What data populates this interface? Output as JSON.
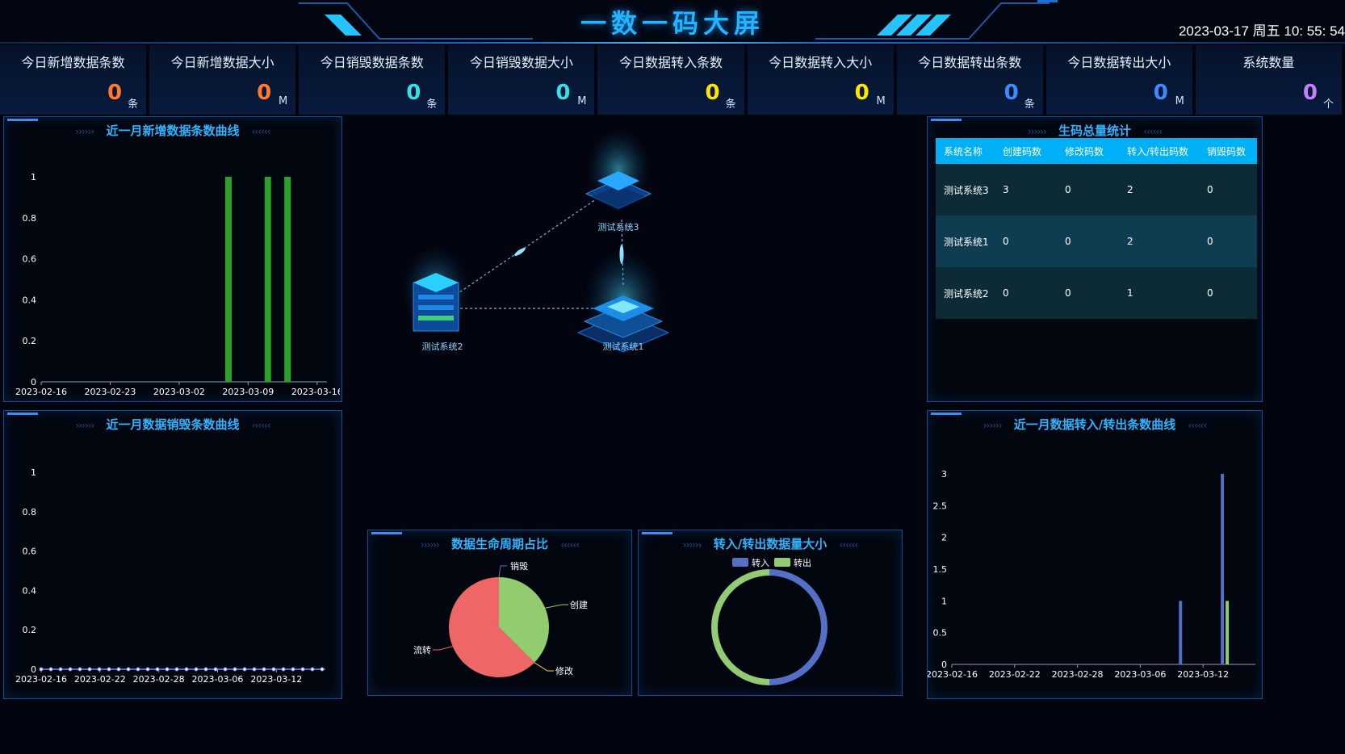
{
  "header": {
    "title": "一数一码大屏",
    "datetime": "2023-03-17 周五 10: 55: 54"
  },
  "stats": [
    {
      "label": "今日新增数据条数",
      "value": "0",
      "unit": "条",
      "color": "#ff7a2e"
    },
    {
      "label": "今日新增数据大小",
      "value": "0",
      "unit": "M",
      "color": "#ff7a2e"
    },
    {
      "label": "今日销毁数据条数",
      "value": "0",
      "unit": "条",
      "color": "#36e0e8"
    },
    {
      "label": "今日销毁数据大小",
      "value": "0",
      "unit": "M",
      "color": "#36e0e8"
    },
    {
      "label": "今日数据转入条数",
      "value": "0",
      "unit": "条",
      "color": "#ffe600"
    },
    {
      "label": "今日数据转入大小",
      "value": "0",
      "unit": "M",
      "color": "#ffe600"
    },
    {
      "label": "今日数据转出条数",
      "value": "0",
      "unit": "条",
      "color": "#3d8bff"
    },
    {
      "label": "今日数据转出大小",
      "value": "0",
      "unit": "M",
      "color": "#3d8bff"
    },
    {
      "label": "系统数量",
      "value": "0",
      "unit": "个",
      "color": "#c77dff"
    }
  ],
  "panels": {
    "new_curve": {
      "title": "近一月新增数据条数曲线",
      "arrows_left": "››››››",
      "arrows_right": "‹‹‹‹‹‹"
    },
    "destroy_curve": {
      "title": "近一月数据销毁条数曲线",
      "arrows_left": "››››››",
      "arrows_right": "‹‹‹‹‹‹"
    },
    "code_stats": {
      "title": "生码总量统计",
      "arrows_left": "››››››",
      "arrows_right": "‹‹‹‹‹‹"
    },
    "transfer_curve": {
      "title": "近一月数据转入/转出条数曲线",
      "arrows_left": "››››››",
      "arrows_right": "‹‹‹‹‹‹"
    },
    "lifecycle": {
      "title": "数据生命周期占比",
      "arrows_left": "››››››",
      "arrows_right": "‹‹‹‹‹‹"
    },
    "transfer_size": {
      "title": "转入/转出数据量大小",
      "arrows_left": "››››››",
      "arrows_right": "‹‹‹‹‹‹"
    }
  },
  "code_table": {
    "headers": [
      "系统名称",
      "创建码数",
      "修改码数",
      "转入/转出码数",
      "销毁码数"
    ],
    "rows": [
      [
        "测试系统3",
        "3",
        "0",
        "2",
        "0"
      ],
      [
        "测试系统1",
        "0",
        "0",
        "2",
        "0"
      ],
      [
        "测试系统2",
        "0",
        "0",
        "1",
        "0"
      ]
    ]
  },
  "topology": {
    "nodes": [
      {
        "name": "测试系统3"
      },
      {
        "name": "测试系统2"
      },
      {
        "name": "测试系统1"
      }
    ]
  },
  "chart_data": [
    {
      "id": "new_curve",
      "type": "bar",
      "title": "近一月新增数据条数曲线",
      "x_tick_labels": [
        "2023-02-16",
        "2023-02-23",
        "2023-03-02",
        "2023-03-09",
        "2023-03-16"
      ],
      "x_range": [
        "2023-02-16",
        "2023-03-17"
      ],
      "bars": [
        {
          "date": "2023-03-07",
          "value": 1
        },
        {
          "date": "2023-03-11",
          "value": 1
        },
        {
          "date": "2023-03-13",
          "value": 1
        }
      ],
      "ylim": [
        0,
        1
      ],
      "y_ticks": [
        0,
        0.2,
        0.4,
        0.6,
        0.8,
        1
      ],
      "color": "#2aa12a"
    },
    {
      "id": "destroy_curve",
      "type": "line",
      "title": "近一月数据销毁条数曲线",
      "x_tick_labels": [
        "2023-02-16",
        "2023-02-22",
        "2023-02-28",
        "2023-03-06",
        "2023-03-12"
      ],
      "x_range": [
        "2023-02-16",
        "2023-03-17"
      ],
      "point_count": 30,
      "value": 0,
      "ylim": [
        0,
        1
      ],
      "y_ticks": [
        0,
        0.2,
        0.4,
        0.6,
        0.8,
        1
      ],
      "color": "#6f8cf5"
    },
    {
      "id": "lifecycle",
      "type": "pie",
      "title": "数据生命周期占比",
      "slices": [
        {
          "name": "创建",
          "value": 3,
          "color": "#93cc6e"
        },
        {
          "name": "修改",
          "value": 0,
          "color": "#fac858"
        },
        {
          "name": "流转",
          "value": 5,
          "color": "#ee6666"
        },
        {
          "name": "销毁",
          "value": 0,
          "color": "#5470c6"
        }
      ]
    },
    {
      "id": "transfer_size",
      "type": "pie",
      "title": "转入/转出数据量大小",
      "legend": [
        "转入",
        "转出"
      ],
      "slices": [
        {
          "name": "转入",
          "value": 1,
          "color": "#5470c6"
        },
        {
          "name": "转出",
          "value": 1,
          "color": "#91cc75"
        }
      ]
    },
    {
      "id": "transfer_curve",
      "type": "bar",
      "title": "近一月数据转入/转出条数曲线",
      "x_tick_labels": [
        "2023-02-16",
        "2023-02-22",
        "2023-02-28",
        "2023-03-06",
        "2023-03-12"
      ],
      "x_range": [
        "2023-02-16",
        "2023-03-17"
      ],
      "series": [
        {
          "name": "转入",
          "color": "#5470c6",
          "bars": [
            {
              "date": "2023-03-10",
              "value": 1
            },
            {
              "date": "2023-03-14",
              "value": 3
            }
          ]
        },
        {
          "name": "转出",
          "color": "#91cc75",
          "bars": [
            {
              "date": "2023-03-14",
              "value": 1
            }
          ]
        }
      ],
      "ylim": [
        0,
        3
      ],
      "y_ticks": [
        0,
        0.5,
        1,
        1.5,
        2,
        2.5,
        3
      ]
    }
  ]
}
